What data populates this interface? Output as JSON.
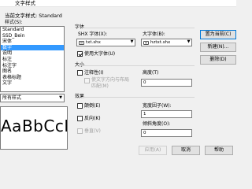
{
  "window": {
    "title": "文字样式"
  },
  "current_style": {
    "label": "当前文字样式:",
    "value": "Standard"
  },
  "styles_label": "样式(S):",
  "style_list": [
    "Standard",
    "SSD_Bein",
    "宋体",
    "数字",
    "说明",
    "标注",
    "标注字",
    "图名",
    "表格标题",
    "文字"
  ],
  "selected_style": "数字",
  "filter": {
    "value": "所有样式"
  },
  "preview": {
    "text": "AaBbCcD"
  },
  "font_group": {
    "label": "字体",
    "shx_label": "SHX 字体(X):",
    "shx_value": "txt.shx",
    "bigfont_label": "大字体(B):",
    "bigfont_value": "hztxt.shx",
    "use_bigfont_label": "使用大字体(U)",
    "use_bigfont_checked": true
  },
  "size_group": {
    "label": "大小",
    "annotative_label": "注释性(I)",
    "annotative_checked": false,
    "match_label_1": "使文字方向与布局",
    "match_label_2": "匹配(M)",
    "height_label": "高度(T)",
    "height_value": "0"
  },
  "effects_group": {
    "label": "效果",
    "upside_label": "颠倒(E)",
    "backwards_label": "反向(K)",
    "vertical_label": "垂直(V)",
    "width_factor_label": "宽度因子(W):",
    "width_factor_value": "1",
    "oblique_label": "倾斜角度(O):",
    "oblique_value": "0"
  },
  "buttons": {
    "set_current": "置为当前(C)",
    "new": "新建(N)...",
    "delete": "删除(D)",
    "apply": "应用(A)",
    "cancel": "取消",
    "help": "帮助"
  },
  "colors": {
    "selection": "#3399ff",
    "primary_border": "#0078d7",
    "dialog_bg": "#f0f0f0"
  }
}
